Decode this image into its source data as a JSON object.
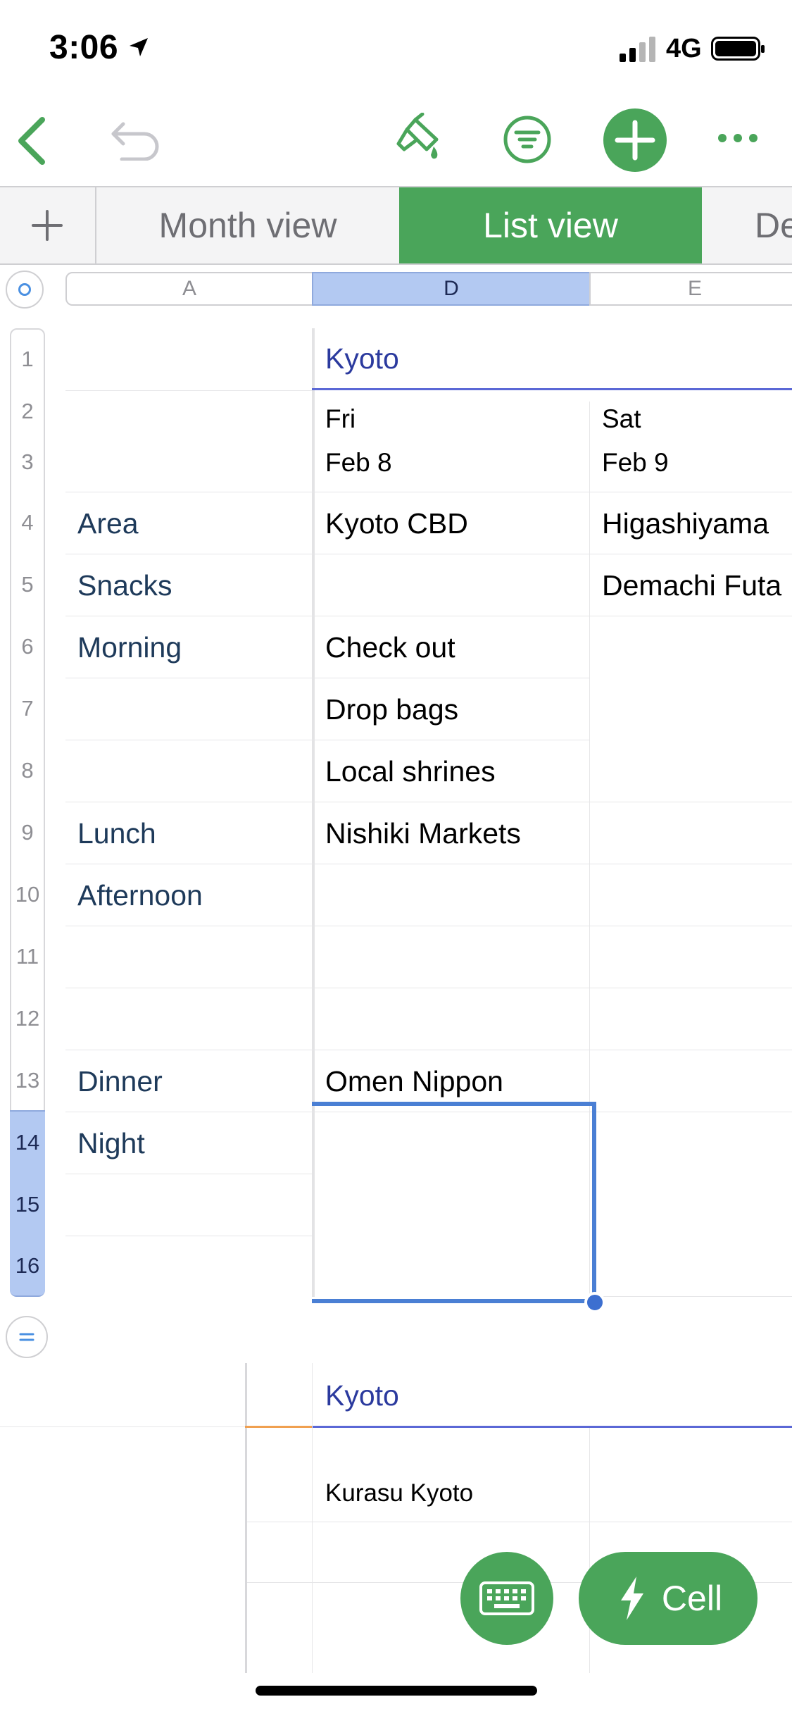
{
  "status_bar": {
    "time": "3:06",
    "network": "4G"
  },
  "tabs": [
    {
      "label": "Month view"
    },
    {
      "label": "List view"
    },
    {
      "label": "De"
    }
  ],
  "columns": [
    "A",
    "D",
    "E"
  ],
  "rows": [
    "1",
    "2",
    "3",
    "4",
    "5",
    "6",
    "7",
    "8",
    "9",
    "10",
    "11",
    "12",
    "13",
    "14",
    "15",
    "16"
  ],
  "table1": {
    "title": "Kyoto",
    "day1": {
      "weekday": "Fri",
      "date": "Feb 8"
    },
    "day2": {
      "weekday": "Sat",
      "date": "Feb 9"
    },
    "labels": {
      "area": "Area",
      "snacks": "Snacks",
      "morning": "Morning",
      "lunch": "Lunch",
      "afternoon": "Afternoon",
      "dinner": "Dinner",
      "night": "Night"
    },
    "d_values": {
      "area": "Kyoto CBD",
      "morning1": "Check out",
      "morning2": "Drop bags",
      "morning3": "Local shrines",
      "lunch": "Nishiki Markets",
      "dinner": "Omen Nippon"
    },
    "e_values": {
      "area": "Higashiyama",
      "snacks": "Demachi Futa"
    }
  },
  "table2": {
    "title": "Kyoto",
    "row1": "Kurasu Kyoto"
  },
  "buttons": {
    "cell": "Cell"
  },
  "colors": {
    "accent": "#4aa55a",
    "selection": "#4a7fd4",
    "title": "#2b3a9e"
  }
}
